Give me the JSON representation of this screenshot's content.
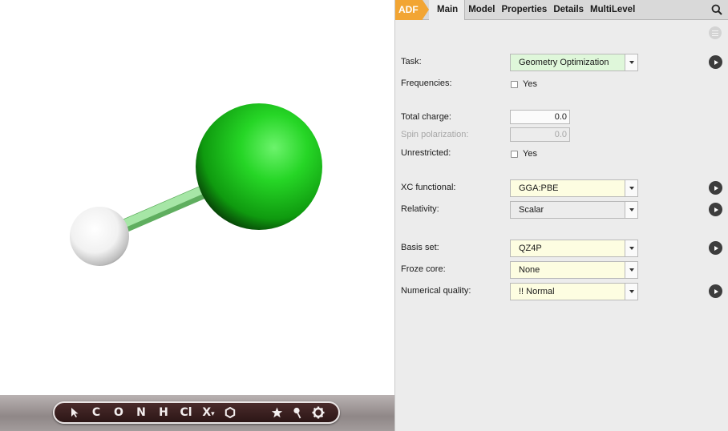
{
  "viewer": {
    "toolbar": {
      "tools": [
        "C",
        "O",
        "N",
        "H",
        "Cl",
        "X"
      ],
      "x_suffix": "▾"
    }
  },
  "tabs": {
    "adf": "ADF",
    "items": [
      "Main",
      "Model",
      "Properties",
      "Details",
      "MultiLevel"
    ],
    "active": "Main"
  },
  "form": {
    "task": {
      "label": "Task:",
      "value": "Geometry Optimization"
    },
    "frequencies": {
      "label": "Frequencies:",
      "option": "Yes"
    },
    "total_charge": {
      "label": "Total charge:",
      "value": "0.0"
    },
    "spin_polarization": {
      "label": "Spin polarization:",
      "value": "0.0"
    },
    "unrestricted": {
      "label": "Unrestricted:",
      "option": "Yes"
    },
    "xc_functional": {
      "label": "XC functional:",
      "value": "GGA:PBE"
    },
    "relativity": {
      "label": "Relativity:",
      "value": "Scalar"
    },
    "basis_set": {
      "label": "Basis set:",
      "value": "QZ4P"
    },
    "froze_core": {
      "label": "Froze core:",
      "value": "None"
    },
    "numerical_quality": {
      "label": "Numerical quality:",
      "value": "!! Normal"
    }
  },
  "colors": {
    "adf_tab": "#f2a533",
    "chlorine": "#22cc22",
    "hydrogen": "#ffffff",
    "bond": "#8fdc8f",
    "task_field": "#dff7da",
    "highlight_field": "#fdfde1"
  },
  "icons": {
    "search": "search-icon",
    "panel_menu": "menu-icon",
    "select_tool": "arrow-cursor-icon",
    "ring": "hexagon-ring-icon",
    "favorite": "star-icon",
    "pin": "pin-icon",
    "settings": "gear-icon",
    "details": "chevron-right-circle-icon"
  }
}
